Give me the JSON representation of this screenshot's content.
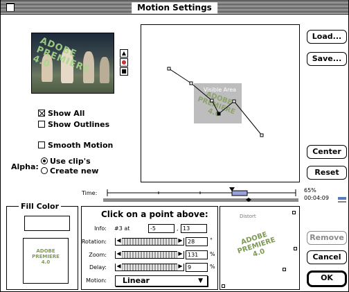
{
  "window": {
    "title": "Motion Settings"
  },
  "preview": {
    "logo_lines": [
      "ADOBE",
      "PREMIERE",
      "4.0"
    ]
  },
  "preview_controls": {
    "up_icon": "▲",
    "mid_icon": "●",
    "stop_icon": "■"
  },
  "options": {
    "show_all": {
      "label": "Show All",
      "checked": true
    },
    "show_outlines": {
      "label": "Show Outlines",
      "checked": false
    },
    "smooth_motion": {
      "label": "Smooth Motion",
      "checked": false
    }
  },
  "alpha": {
    "label": "Alpha:",
    "options": [
      "Use clip's",
      "Create new"
    ],
    "selected": "Use clip's"
  },
  "motion_area": {
    "visible_area_label": "Visible Area",
    "logo_lines": [
      "ADOBE",
      "PREMIERE",
      "4.0"
    ]
  },
  "buttons": {
    "load": "Load...",
    "save": "Save...",
    "center": "Center",
    "reset": "Reset",
    "remove": "Remove",
    "cancel": "Cancel",
    "ok": "OK"
  },
  "timeline": {
    "label": "Time:",
    "zoom": "65%",
    "timecode": "00:04:09"
  },
  "fill_color": {
    "title": "Fill Color",
    "swatch_color": "#ffffff",
    "logo_lines": [
      "ADOBE",
      "PREMIERE",
      "4.0"
    ]
  },
  "controls": {
    "heading": "Click on a point above:",
    "info": {
      "label": "Info:",
      "point_text": "#3 at",
      "x": "-5",
      "separator": ",",
      "y": "13"
    },
    "rotation": {
      "label": "Rotation:",
      "value": "28",
      "unit": "°"
    },
    "zoom": {
      "label": "Zoom:",
      "value": "131",
      "unit": "%"
    },
    "delay": {
      "label": "Delay:",
      "value": "9",
      "unit": "%"
    },
    "motion": {
      "label": "Motion:",
      "value": "Linear"
    }
  },
  "distortion": {
    "label": "Distort",
    "logo_lines": [
      "ADOBE",
      "PREMIERE",
      "4.0"
    ]
  },
  "colors": {
    "accent": "#000000",
    "visible_area": "#bdbdbd",
    "logo_green": "#7e9a54"
  }
}
